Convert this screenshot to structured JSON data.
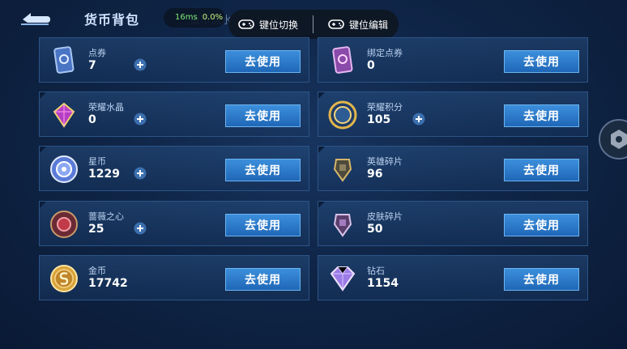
{
  "header": {
    "title": "货币背包",
    "perf_ms": "16ms",
    "perf_pct": "0.0%",
    "flow_label": "货币流水",
    "keymap_switch": "键位切换",
    "keymap_edit": "键位编辑"
  },
  "use_label": "去使用",
  "currencies": [
    {
      "name": "点券",
      "value": "7",
      "icon": "voucher-card-icon",
      "has_plus": true
    },
    {
      "name": "绑定点券",
      "value": "0",
      "icon": "bound-voucher-card-icon",
      "has_plus": false
    },
    {
      "name": "荣耀水晶",
      "value": "0",
      "icon": "glory-crystal-icon",
      "has_plus": true
    },
    {
      "name": "荣耀积分",
      "value": "105",
      "icon": "glory-points-icon",
      "has_plus": true
    },
    {
      "name": "星币",
      "value": "1229",
      "icon": "star-coin-icon",
      "has_plus": true
    },
    {
      "name": "英雄碎片",
      "value": "96",
      "icon": "hero-fragment-icon",
      "has_plus": false
    },
    {
      "name": "蔷薇之心",
      "value": "25",
      "icon": "rose-heart-icon",
      "has_plus": true
    },
    {
      "name": "皮肤碎片",
      "value": "50",
      "icon": "skin-fragment-icon",
      "has_plus": false
    },
    {
      "name": "金币",
      "value": "17742",
      "icon": "gold-coin-icon",
      "has_plus": false
    },
    {
      "name": "钻石",
      "value": "1154",
      "icon": "diamond-icon",
      "has_plus": false
    }
  ]
}
